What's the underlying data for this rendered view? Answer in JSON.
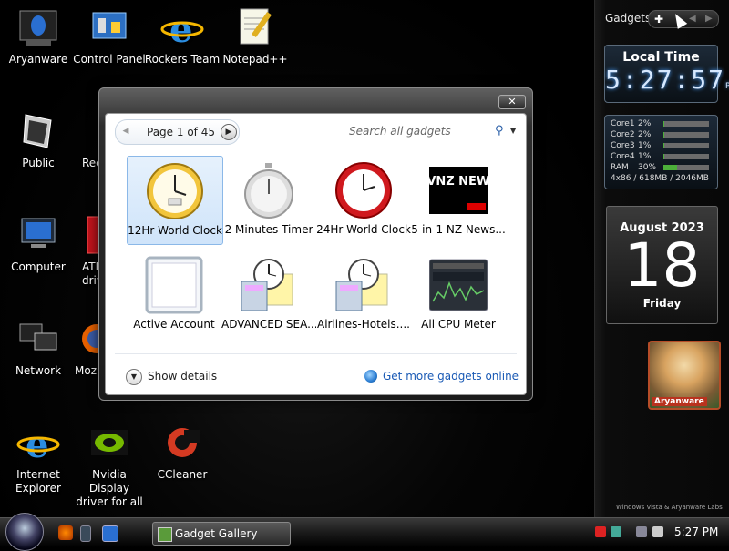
{
  "desktop": {
    "icons": [
      {
        "label": "Aryanware",
        "icon": "alienware-icon"
      },
      {
        "label": "Control Panel",
        "icon": "control-panel-icon"
      },
      {
        "label": "Rockers Team",
        "icon": "internet-explorer-icon"
      },
      {
        "label": "Notepad++",
        "icon": "notepad-icon"
      },
      {
        "label": "Public",
        "icon": "folder-icon"
      },
      {
        "label": "Rec",
        "icon": "recycle-bin-icon"
      },
      {
        "label": "Computer",
        "icon": "computer-icon"
      },
      {
        "label": "ATI",
        "sub": "driv",
        "icon": "ati-icon"
      },
      {
        "label": "Network",
        "icon": "network-icon"
      },
      {
        "label": "Mozi",
        "icon": "firefox-icon"
      },
      {
        "label": "Internet",
        "sub": "Explorer",
        "icon": "internet-explorer-icon"
      },
      {
        "label": "Nvidia Display",
        "sub": "driver for all ...",
        "icon": "nvidia-icon"
      },
      {
        "label": "CCleaner",
        "icon": "ccleaner-icon"
      }
    ]
  },
  "sidebar": {
    "title": "Gadgets",
    "clock": {
      "title": "Local Time",
      "time": "5:27:57",
      "ampm": "PM"
    },
    "cpu": {
      "rows": [
        {
          "label": "Core1",
          "value": "2%",
          "level": 0.02
        },
        {
          "label": "Core2",
          "value": "2%",
          "level": 0.02
        },
        {
          "label": "Core3",
          "value": "1%",
          "level": 0.01
        },
        {
          "label": "Core4",
          "value": "1%",
          "level": 0.01
        },
        {
          "label": "RAM",
          "value": "30%",
          "level": 0.3
        }
      ],
      "footer": "4x86 / 618MB / 2046MB"
    },
    "calendar": {
      "month": "August 2023",
      "day": "18",
      "weekday": "Friday"
    },
    "user": {
      "name": "Aryanware"
    },
    "watermark": "Windows Vista & Aryanware Labs"
  },
  "gallery": {
    "close_label": "✕",
    "pager": {
      "text": "Page 1 of 45"
    },
    "search": {
      "placeholder": "Search all gadgets"
    },
    "tiles": [
      {
        "label": "12Hr World Clock",
        "icon": "world-clock-icon",
        "selected": true
      },
      {
        "label": "2 Minutes Timer",
        "icon": "stopwatch-icon"
      },
      {
        "label": "24Hr World Clock",
        "icon": "red-clock-icon"
      },
      {
        "label": "5-in-1 NZ News...",
        "icon": "tvnz-news-icon",
        "thumb_text": "TVNZ NEWS"
      },
      {
        "label": "Active Account",
        "icon": "blank-frame-icon"
      },
      {
        "label": "ADVANCED SEA...",
        "icon": "calculator-clock-icon"
      },
      {
        "label": "Airlines-Hotels....",
        "icon": "calculator-clock-icon"
      },
      {
        "label": "All CPU Meter",
        "icon": "cpu-meter-icon"
      }
    ],
    "show_details": "Show details",
    "get_more": "Get more gadgets online"
  },
  "taskbar": {
    "window_button": "Gadget Gallery",
    "time": "5:27 PM"
  },
  "colors": {
    "accent": "#2a7cd1",
    "selected_tile": "#cfe4fa",
    "link": "#1a5ab5"
  }
}
